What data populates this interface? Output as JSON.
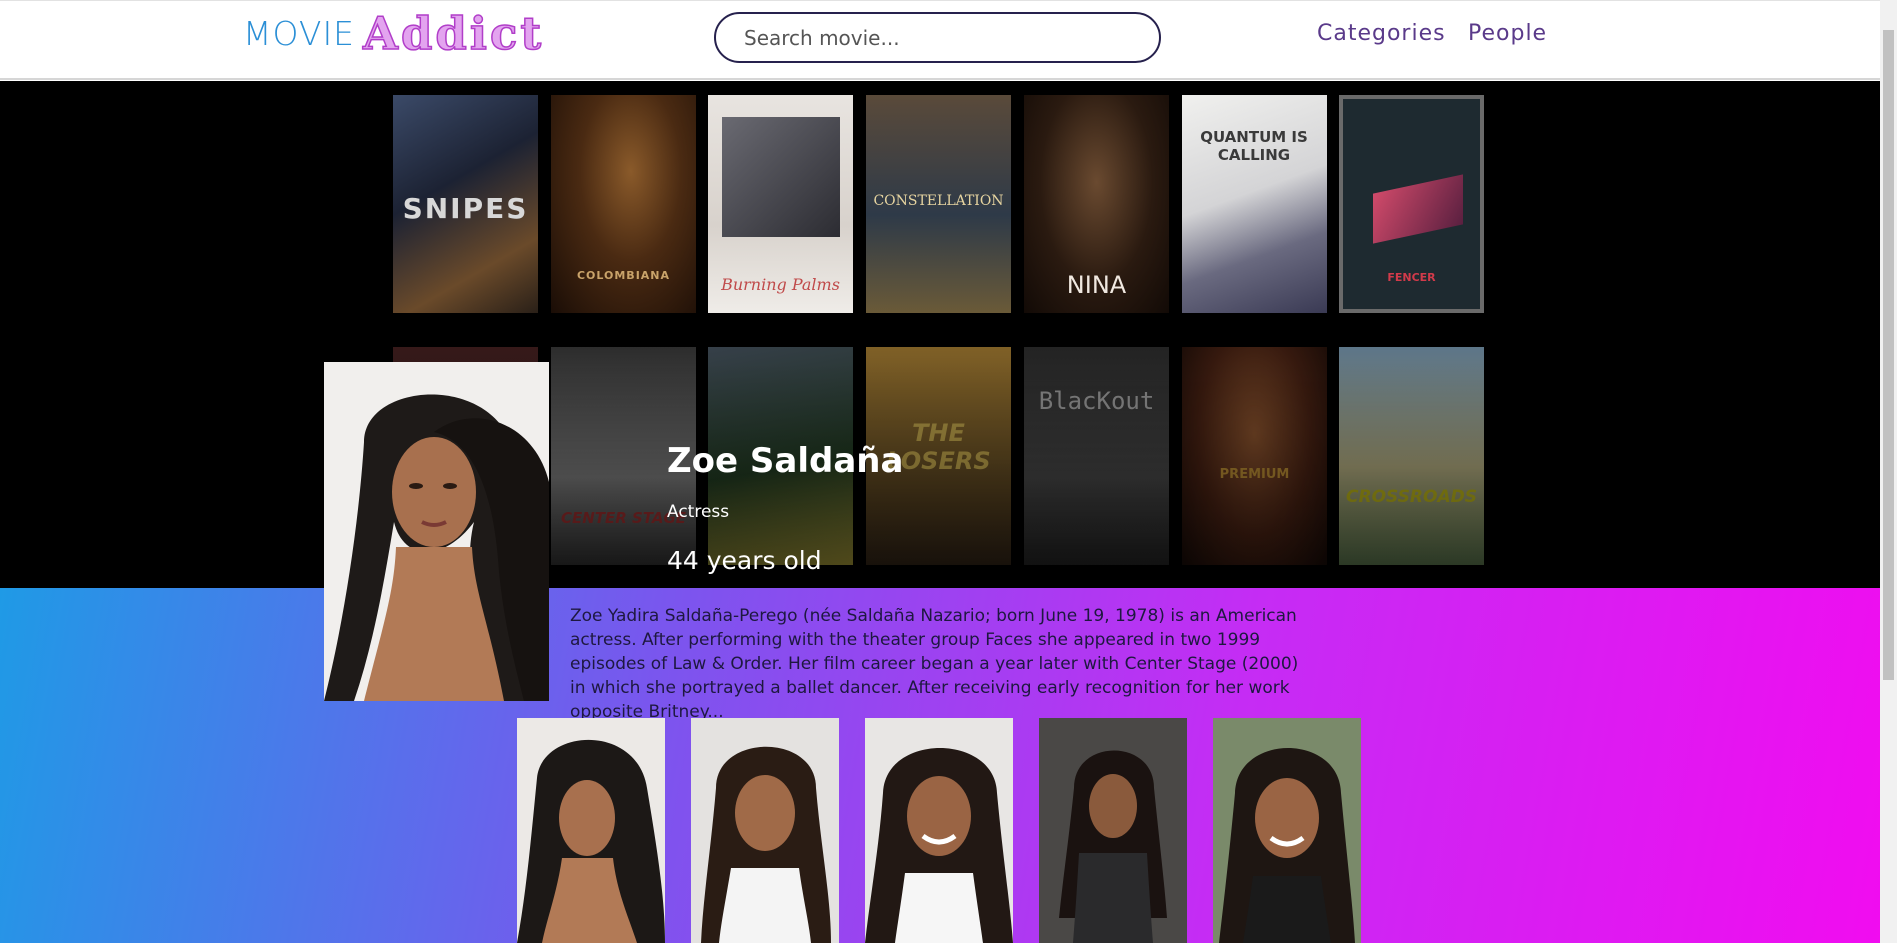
{
  "header": {
    "logo_movie": "MOVIE",
    "logo_addict": "Addict",
    "search_placeholder": "Search movie...",
    "nav_categories": "Categories",
    "nav_people": "People"
  },
  "posters": [
    {
      "title": "SNIPES"
    },
    {
      "title": "COLOMBIANA"
    },
    {
      "title": "Burning Palms"
    },
    {
      "title": "CONSTELLATION"
    },
    {
      "title": "NINA"
    },
    {
      "title": "QUANTUM IS CALLING"
    },
    {
      "title": "FENCER"
    },
    {
      "title": ""
    },
    {
      "title": "CENTER STAGE"
    },
    {
      "title": ""
    },
    {
      "title": "THE LOSERS"
    },
    {
      "title": "BlacKout"
    },
    {
      "title": "PREMIUM"
    },
    {
      "title": "CROSSROADS"
    }
  ],
  "person": {
    "name": "Zoe Saldaña",
    "role": "Actress",
    "age": "44 years old",
    "bio": "Zoe Yadira Saldaña-Perego (née Saldaña Nazario; born June 19, 1978) is an American actress. After performing with the theater group Faces she appeared in two 1999 episodes of Law & Order. Her film career began a year later with Center Stage (2000) in which she portrayed a ballet dancer. After receiving early recognition for her work opposite Britney..."
  },
  "colors": {
    "gradient_start": "#1f9ae6",
    "gradient_end": "#f10cf0",
    "hero_bg": "#000000",
    "nav_text": "#5a3a8a",
    "logo_blue": "#2b8fd6",
    "logo_pink": "#e3a4ef"
  }
}
